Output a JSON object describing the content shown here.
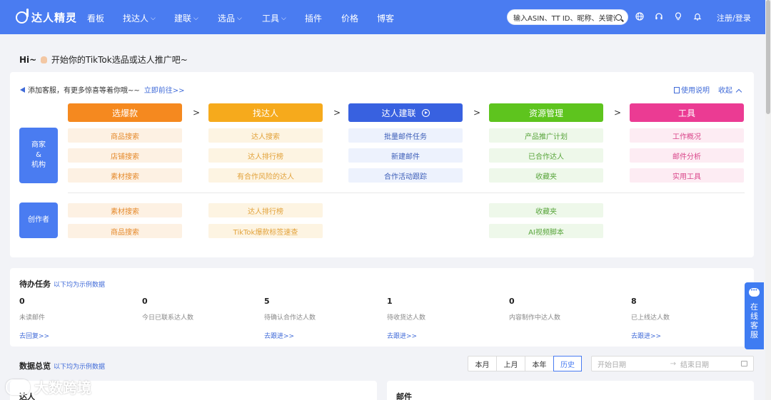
{
  "brand": {
    "name": "达人精灵"
  },
  "nav": {
    "items": [
      {
        "label": "看板",
        "dropdown": false
      },
      {
        "label": "找达人",
        "dropdown": true
      },
      {
        "label": "建联",
        "dropdown": true
      },
      {
        "label": "选品",
        "dropdown": true
      },
      {
        "label": "工具",
        "dropdown": true
      },
      {
        "label": "插件",
        "dropdown": false
      },
      {
        "label": "价格",
        "dropdown": false
      },
      {
        "label": "博客",
        "dropdown": false
      }
    ],
    "search_placeholder": "输入ASIN、TT ID、昵称、关键词",
    "icons": [
      "globe-icon",
      "headset-icon",
      "lightbulb-icon",
      "bell-icon"
    ],
    "login": "注册/登录"
  },
  "greeting": {
    "hi": "Hi~",
    "text": "开始你的TikTok选品或达人推广吧~"
  },
  "notice": {
    "text": "添加客服，有更多惊喜等着你哦~~",
    "link": "立即前往>>",
    "manual": "使用说明",
    "collapse": "收起"
  },
  "roles": {
    "merchant": "商家\n&\n机构",
    "creator": "创作者"
  },
  "columns": [
    {
      "title": "选爆款",
      "color": "#f5891f",
      "merchant": [
        "商品搜索",
        "店铺搜索",
        "素材搜索"
      ],
      "creator": [
        "素材搜索",
        "商品搜索"
      ]
    },
    {
      "title": "找达人",
      "color": "#f6aa1c",
      "merchant": [
        "达人搜索",
        "达人排行榜",
        "有合作风险的达人"
      ],
      "creator": [
        "达人排行榜",
        "TikTok爆款标签速查"
      ]
    },
    {
      "title": "达人建联",
      "color": "#3861e0",
      "merchant": [
        "批量邮件任务",
        "新建邮件",
        "合作活动跟踪"
      ],
      "creator": []
    },
    {
      "title": "资源管理",
      "color": "#5ec41e",
      "merchant": [
        "产品推广计划",
        "已合作达人",
        "收藏夹"
      ],
      "creator": [
        "收藏夹",
        "AI视频脚本"
      ]
    },
    {
      "title": "工具",
      "color": "#eb3b93",
      "merchant": [
        "工作概况",
        "邮件分析",
        "实用工具"
      ],
      "creator": []
    }
  ],
  "todo": {
    "title": "待办任务",
    "subtitle": "以下均为示例数据",
    "stats": [
      {
        "value": "0",
        "label": "未读邮件",
        "link": "去回复>>"
      },
      {
        "value": "0",
        "label": "今日已联系达人数",
        "link": ""
      },
      {
        "value": "5",
        "label": "待确认合作达人数",
        "link": "去跟进>>"
      },
      {
        "value": "1",
        "label": "待收货达人数",
        "link": "去跟进>>"
      },
      {
        "value": "0",
        "label": "内容制作中达人数",
        "link": ""
      },
      {
        "value": "8",
        "label": "已上线达人数",
        "link": "去跟进>>"
      }
    ]
  },
  "overview": {
    "title": "数据总览",
    "subtitle": "以下均为示例数据",
    "periods": [
      "本月",
      "上月",
      "本年",
      "历史"
    ],
    "active_period": "历史",
    "start_placeholder": "开始日期",
    "end_placeholder": "结束日期",
    "cards": [
      "达人",
      "邮件"
    ]
  },
  "service": {
    "label": "在线客服"
  },
  "watermark": {
    "text": "大数跨境"
  }
}
